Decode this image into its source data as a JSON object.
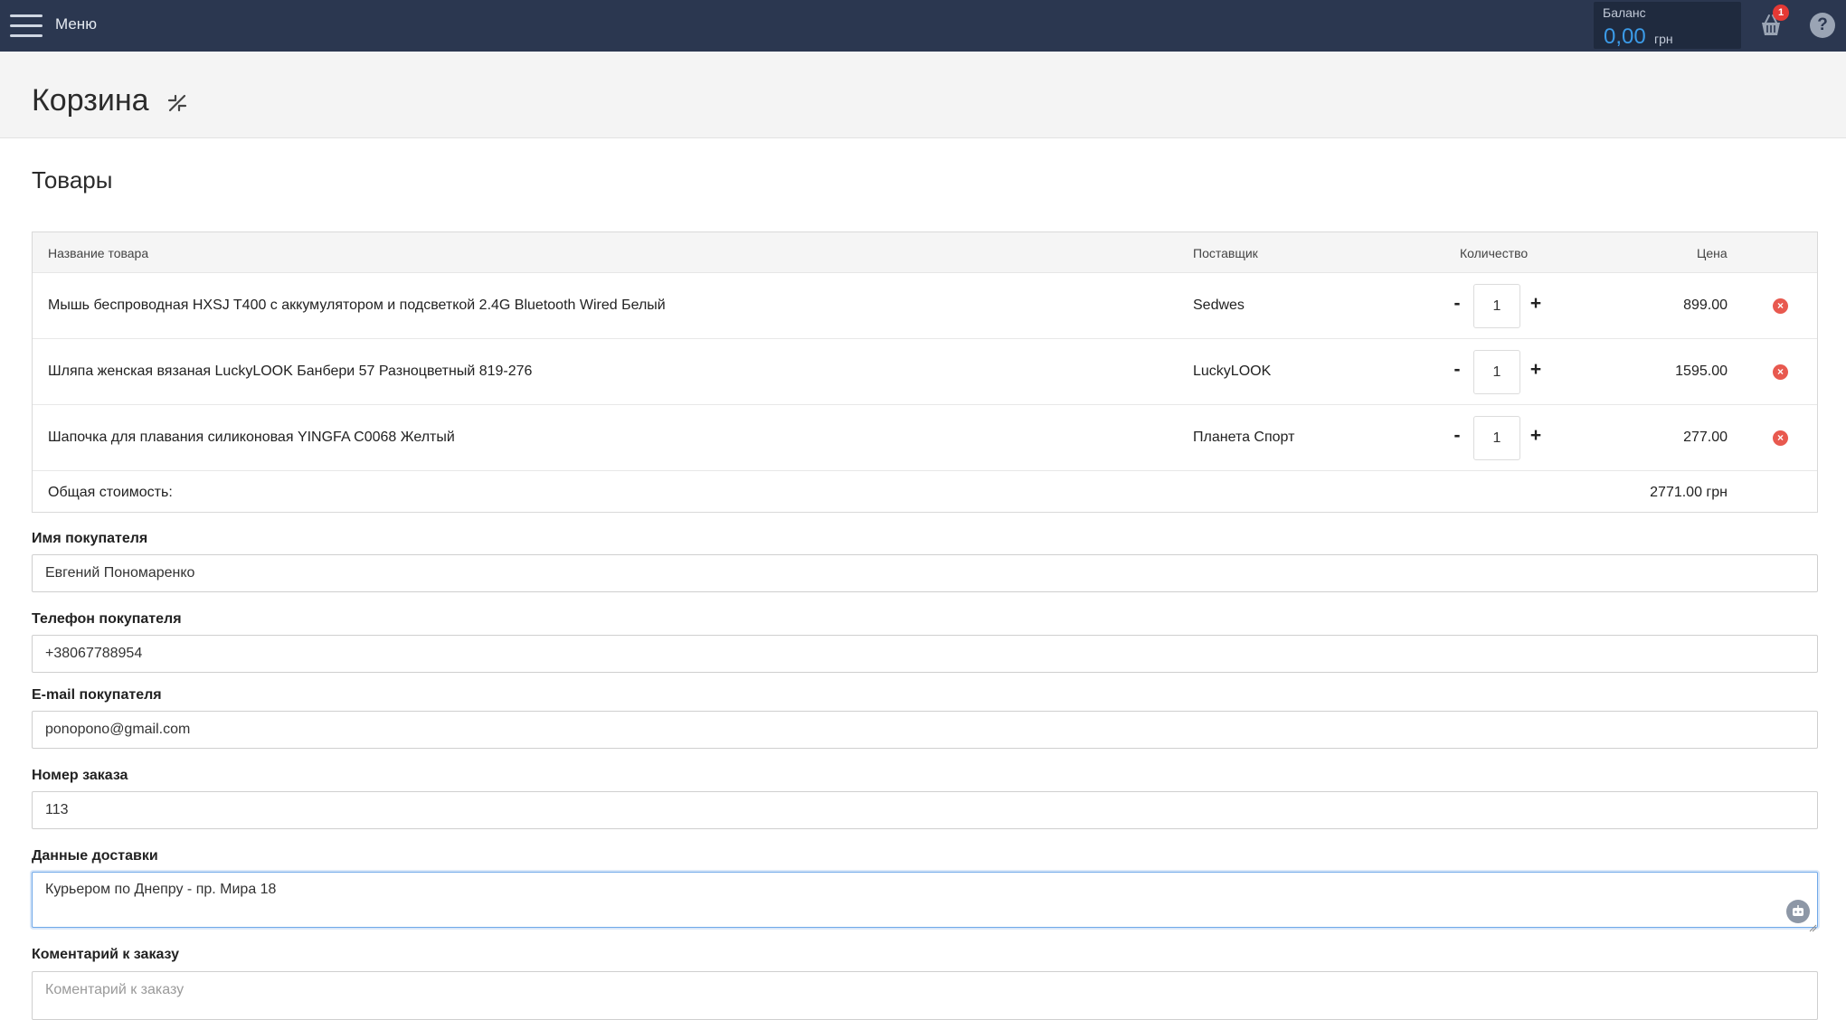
{
  "topbar": {
    "menu_label": "Меню",
    "balance_title": "Баланс",
    "balance_value": "0,00",
    "balance_currency": "грн",
    "cart_count": "1",
    "help_symbol": "?"
  },
  "page": {
    "title": "Корзина",
    "section_title": "Товары"
  },
  "table": {
    "headers": {
      "name": "Название товара",
      "supplier": "Поставщик",
      "quantity": "Количество",
      "price": "Цена"
    },
    "rows": [
      {
        "name": "Мышь беспроводная HXSJ T400 с аккумулятором и подсветкой 2.4G Bluetooth Wired Белый",
        "supplier": "Sedwes",
        "quantity": "1",
        "price": "899.00"
      },
      {
        "name": "Шляпа женская вязаная LuckyLOOK Банбери 57 Разноцветный 819-276",
        "supplier": "LuckyLOOK",
        "quantity": "1",
        "price": "1595.00"
      },
      {
        "name": "Шапочка для плавания силиконовая YINGFA C0068 Желтый",
        "supplier": "Планета Спорт",
        "quantity": "1",
        "price": "277.00"
      }
    ],
    "minus_label": "-",
    "plus_label": "+",
    "remove_symbol": "×",
    "total_label": "Общая стоимость:",
    "total_value": "2771.00 грн"
  },
  "form": {
    "buyer_name_label": "Имя покупателя",
    "buyer_name_value": "Евгений Пономаренко",
    "buyer_phone_label": "Телефон покупателя",
    "buyer_phone_value": "+38067788954",
    "buyer_email_label": "E-mail покупателя",
    "buyer_email_value": "ponopono@gmail.com",
    "order_number_label": "Номер заказа",
    "order_number_value": "113",
    "delivery_label": "Данные доставки",
    "delivery_value": "Курьером по Днепру - пр. Мира 18",
    "comment_label": "Коментарий к заказу",
    "comment_placeholder": "Коментарий к заказу"
  },
  "colors": {
    "topbar": "#2b3750",
    "balance_accent": "#3b9be8",
    "badge": "#e53935",
    "remove": "#e8594f"
  }
}
